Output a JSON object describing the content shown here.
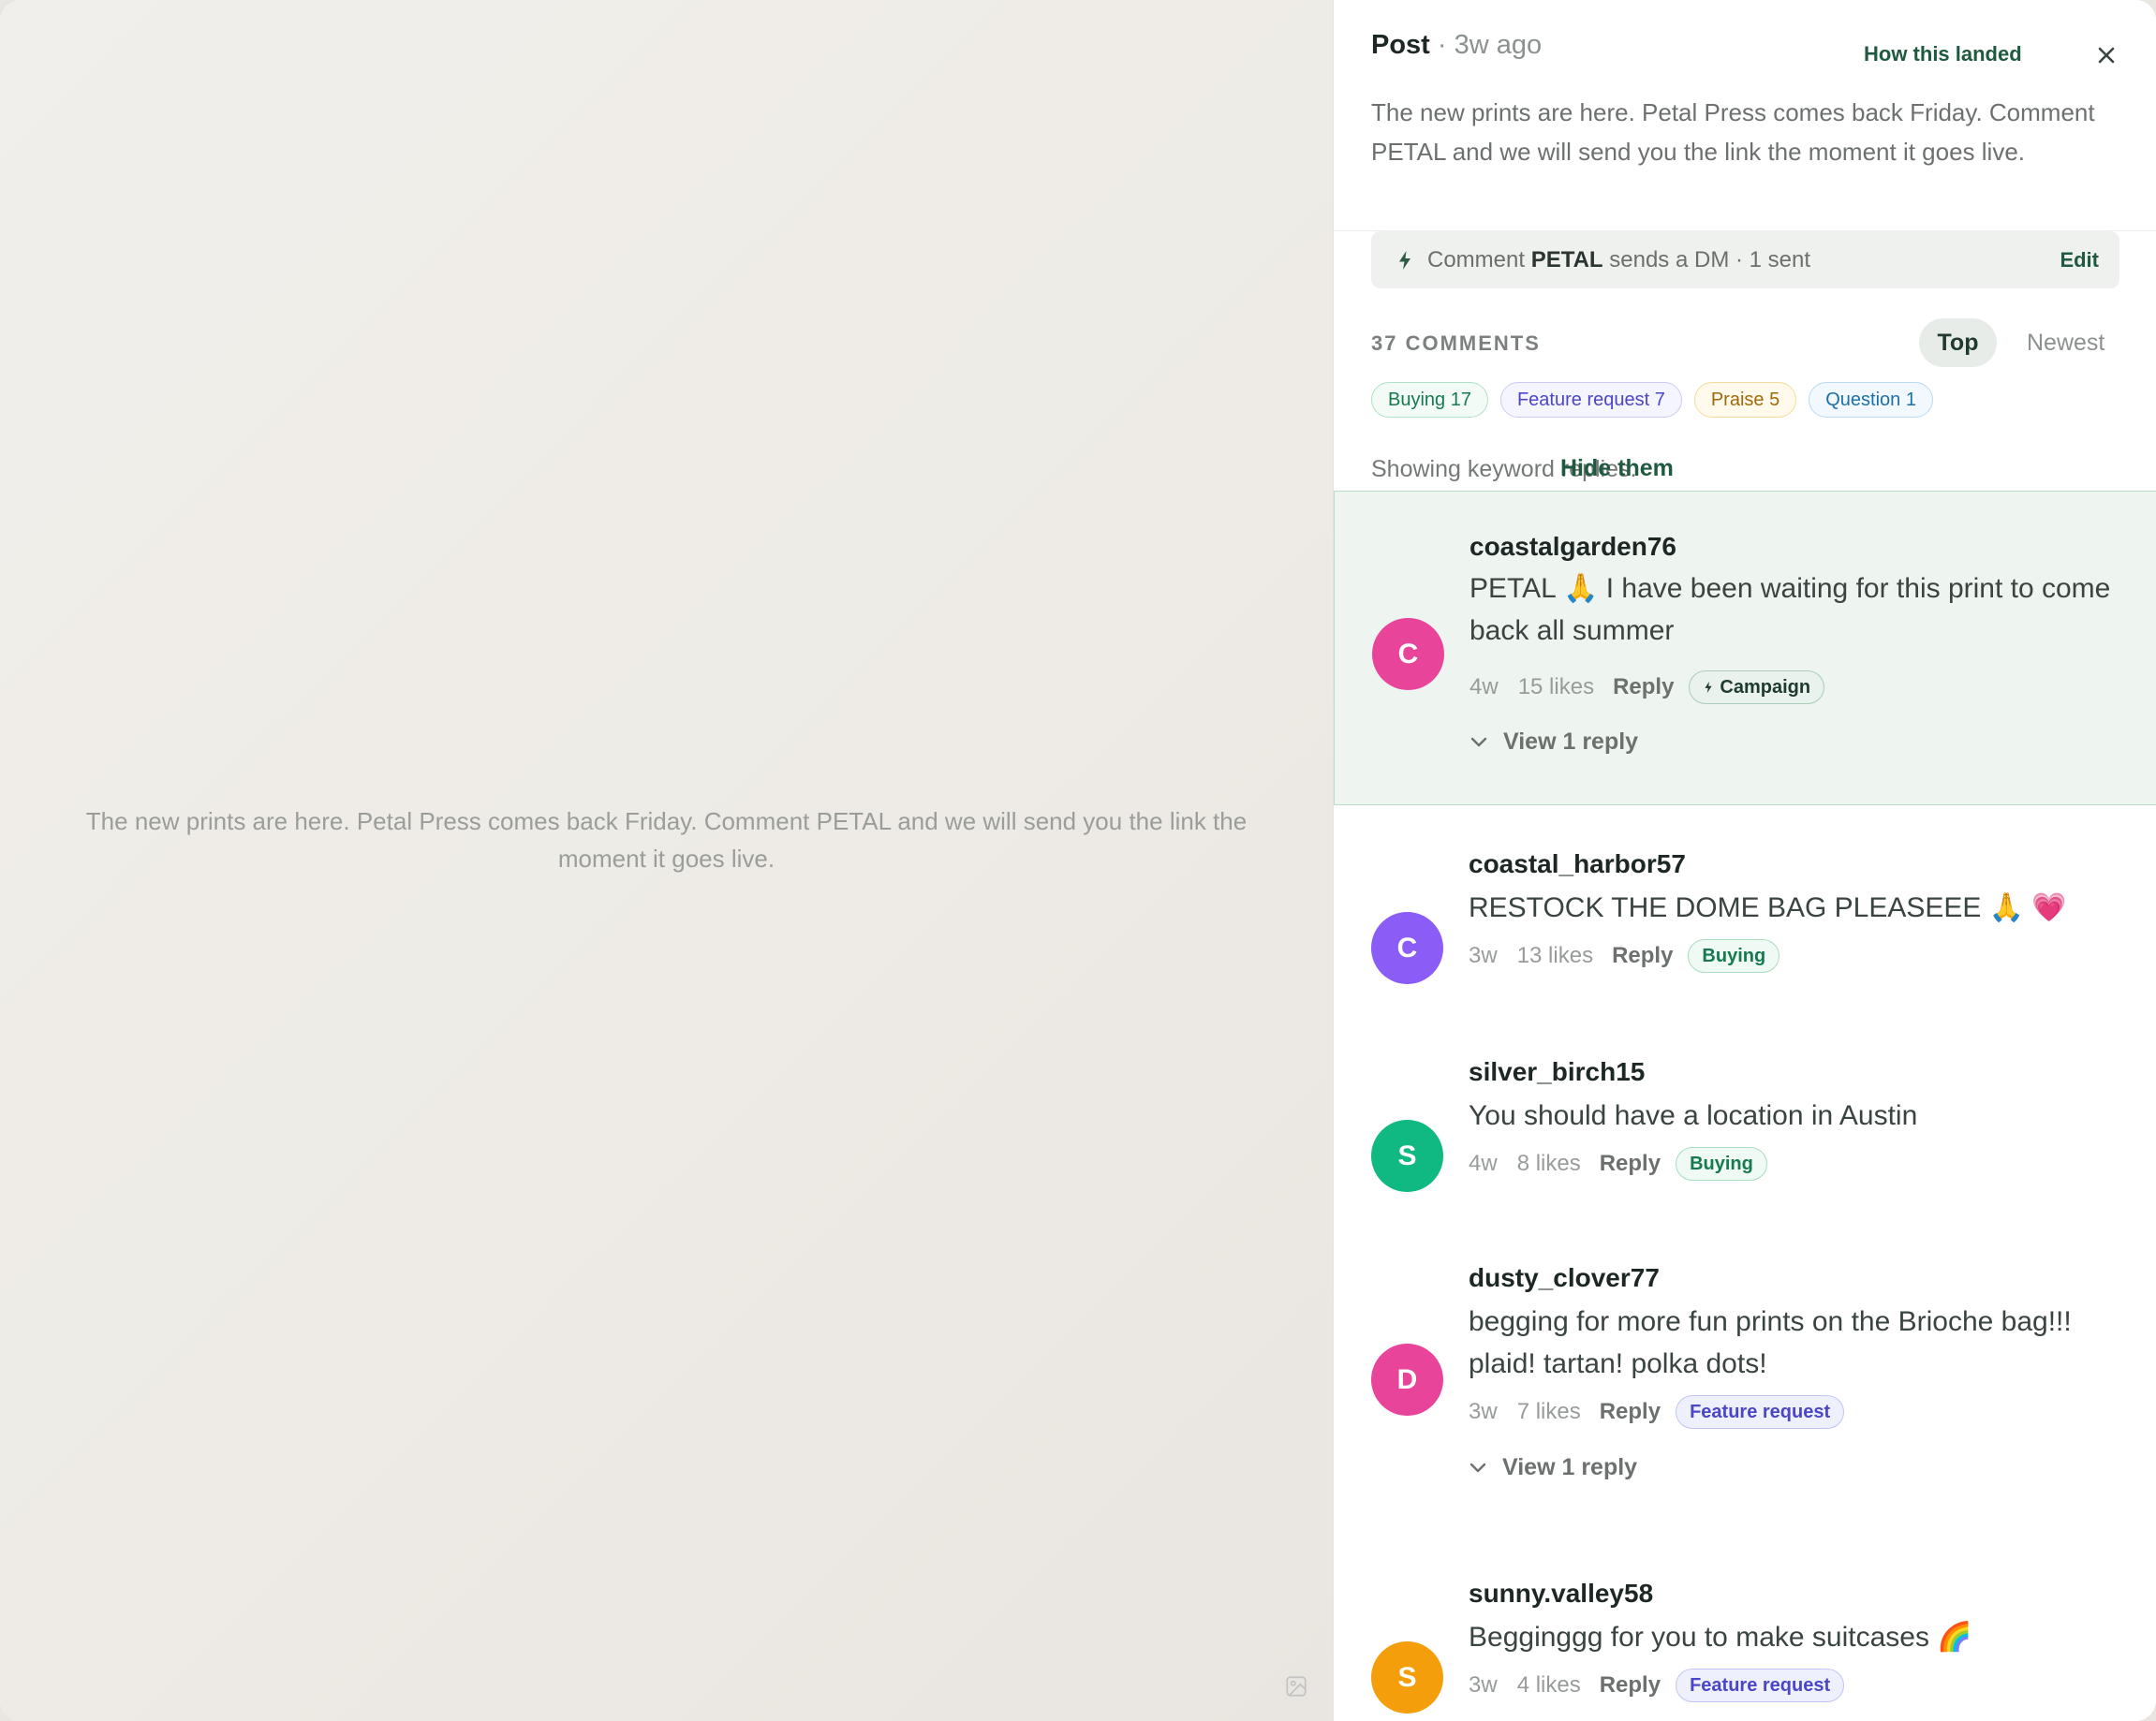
{
  "media": {
    "caption": "The new prints are here. Petal Press comes back Friday. Comment PETAL and we will send you the link the moment it goes live.",
    "icon": "image-icon"
  },
  "post": {
    "label": "Post",
    "separator": "·",
    "age": "3w ago",
    "how_landed": "How this landed",
    "close_icon": "close-icon",
    "caption": "The new prints are here. Petal Press comes back Friday. Comment PETAL and we will send you the link the moment it goes live."
  },
  "automation": {
    "prefix": "Comment",
    "keyword": "PETAL",
    "suffix": "sends a DM · 1 sent",
    "edit": "Edit",
    "icon": "bolt-icon"
  },
  "comments_header": {
    "count": "37 COMMENTS",
    "sort_top": "Top",
    "sort_newest": "Newest"
  },
  "chips": [
    {
      "label": "Buying 17",
      "color": "#167a4e"
    },
    {
      "label": "Feature request 7",
      "color": "#4a46c7"
    },
    {
      "label": "Praise 5",
      "color": "#a06a0a"
    },
    {
      "label": "Question 1",
      "color": "#1d70a6"
    }
  ],
  "keyword_notice": {
    "text": "Showing keyword replies.",
    "action": "Hide them"
  },
  "comments": [
    {
      "initial": "C",
      "avatar_color": "#e8459a",
      "username": "coastalgarden76",
      "text": "PETAL 🙏 I have been waiting for this print to come back all summer",
      "age": "4w",
      "likes": "15 likes",
      "reply": "Reply",
      "tag": "Campaign",
      "view_replies": "View 1 reply"
    },
    {
      "initial": "C",
      "avatar_color": "#8b5cf6",
      "username": "coastal_harbor57",
      "text": "RESTOCK THE DOME BAG PLEASEEE 🙏 💗",
      "age": "3w",
      "likes": "13 likes",
      "reply": "Reply",
      "tag": "Buying"
    },
    {
      "initial": "S",
      "avatar_color": "#10b981",
      "username": "silver_birch15",
      "text": "You should have a location in Austin",
      "age": "4w",
      "likes": "8 likes",
      "reply": "Reply",
      "tag": "Buying"
    },
    {
      "initial": "D",
      "avatar_color": "#e8459a",
      "username": "dusty_clover77",
      "text": "begging for more fun prints on the Brioche bag!!! plaid! tartan! polka dots!",
      "age": "3w",
      "likes": "7 likes",
      "reply": "Reply",
      "tag": "Feature request",
      "view_replies": "View 1 reply"
    },
    {
      "initial": "S",
      "avatar_color": "#f59e0b",
      "username": "sunny.valley58",
      "text": "Begginggg for you to make suitcases 🌈",
      "age": "3w",
      "likes": "4 likes",
      "reply": "Reply",
      "tag": "Feature request"
    }
  ]
}
